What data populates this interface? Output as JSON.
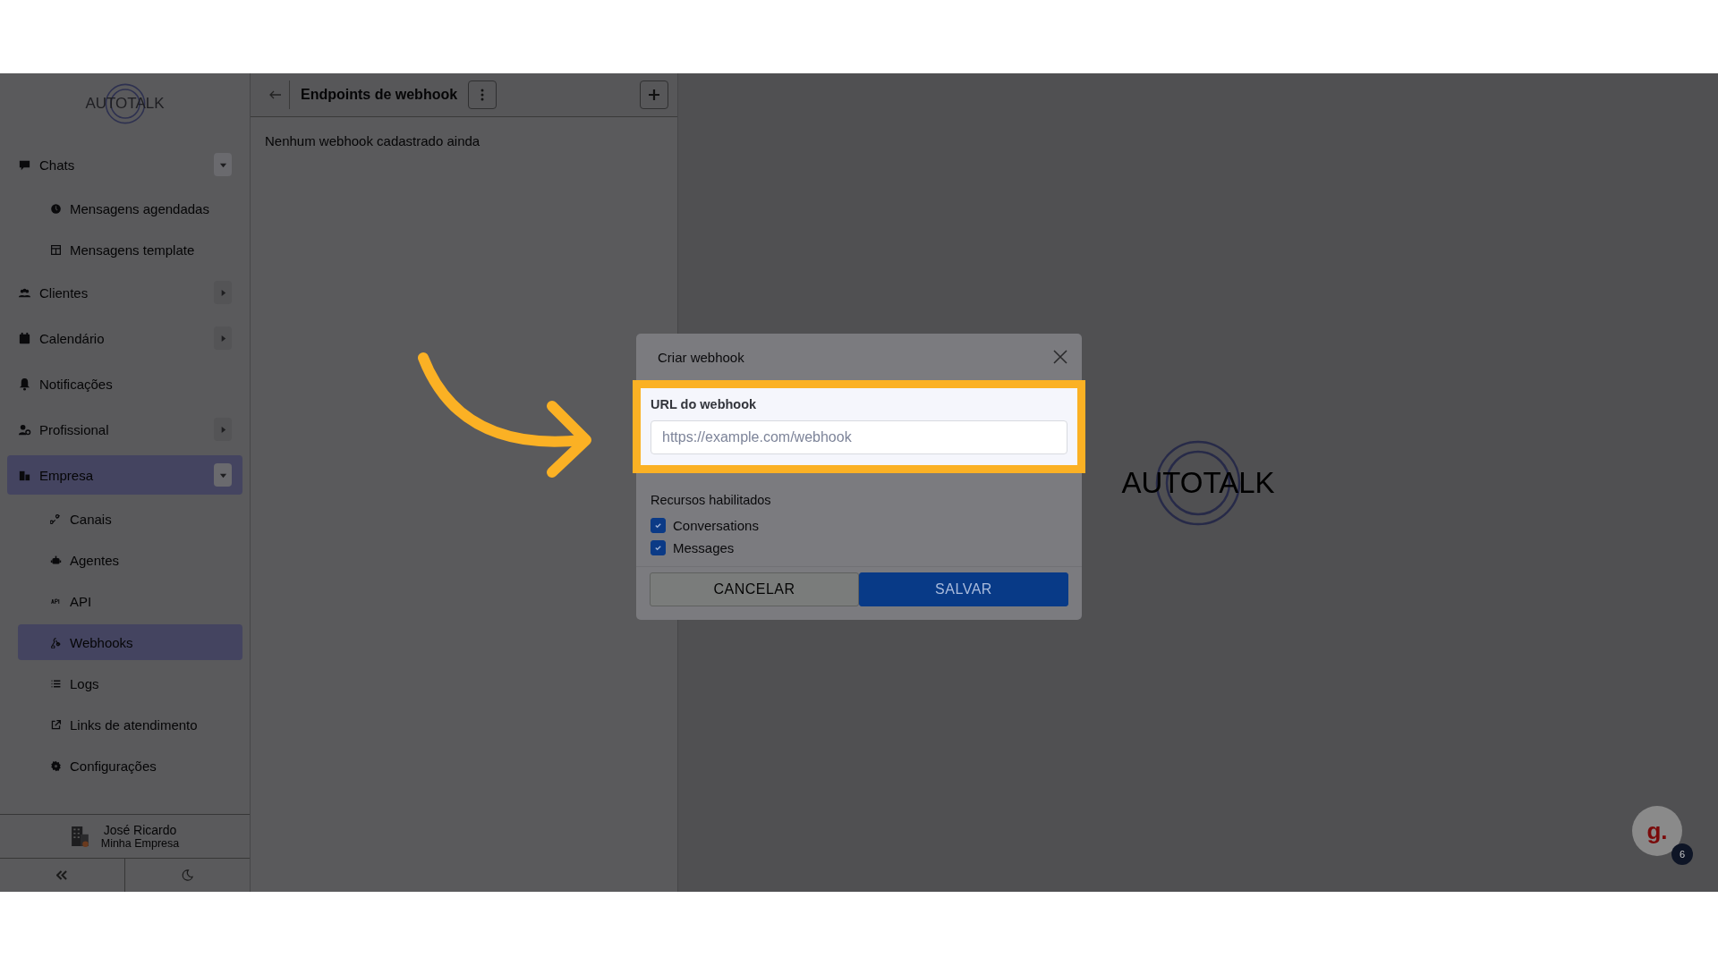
{
  "sidebar": {
    "logo": "AUTOTALK",
    "items": [
      {
        "label": "Chats",
        "kind": "group",
        "expanded": true,
        "selected": false,
        "children": [
          {
            "label": "Mensagens agendadas",
            "selected": false
          },
          {
            "label": "Mensagens template",
            "selected": false
          }
        ]
      },
      {
        "label": "Clientes",
        "kind": "group",
        "expanded": false,
        "selected": false
      },
      {
        "label": "Calendário",
        "kind": "group",
        "expanded": false,
        "selected": false
      },
      {
        "label": "Notificações",
        "kind": "link",
        "selected": false
      },
      {
        "label": "Profissional",
        "kind": "group",
        "expanded": false,
        "selected": false
      },
      {
        "label": "Empresa",
        "kind": "group",
        "expanded": true,
        "selected": true,
        "children": [
          {
            "label": "Canais",
            "selected": false
          },
          {
            "label": "Agentes",
            "selected": false
          },
          {
            "label": "API",
            "selected": false
          },
          {
            "label": "Webhooks",
            "selected": true
          },
          {
            "label": "Logs",
            "selected": false
          },
          {
            "label": "Links de atendimento",
            "selected": false
          },
          {
            "label": "Configurações",
            "selected": false
          }
        ]
      }
    ],
    "user": {
      "name": "José Ricardo",
      "company": "Minha Empresa"
    }
  },
  "panel": {
    "title": "Endpoints de webhook",
    "empty_message": "Nenhum webhook cadastrado ainda"
  },
  "brand_logo": "AUTOTALK",
  "dialog": {
    "title": "Criar webhook",
    "url_label": "URL do webhook",
    "placeholder": "https://example.com/webhook",
    "resources_label": "Recursos habilitados",
    "resources": [
      {
        "label": "Conversations",
        "checked": true
      },
      {
        "label": "Messages",
        "checked": true
      }
    ],
    "buttons": [
      {
        "label": "CANCELAR",
        "kind": "secondary"
      },
      {
        "label": "SALVAR",
        "kind": "primary"
      }
    ]
  },
  "help_widget": {
    "letter": "g.",
    "count": "6"
  }
}
